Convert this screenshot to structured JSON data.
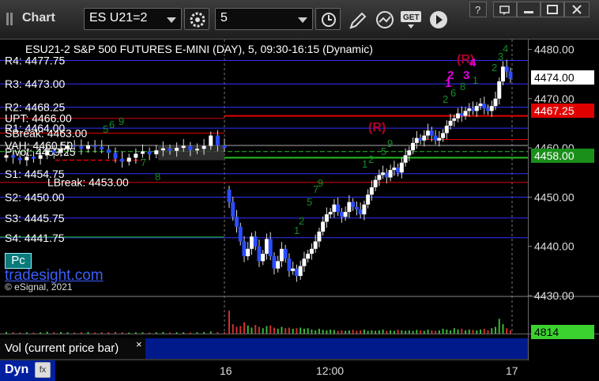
{
  "toolbar": {
    "title": "Chart",
    "symbol": "ES U21=2",
    "interval": "5",
    "icons": [
      "gear-icon",
      "clock-icon",
      "pencil-icon",
      "study-icon",
      "get-icon",
      "play-icon"
    ]
  },
  "window": {
    "icons": [
      "help-icon",
      "restore-icon",
      "minimize-icon",
      "maximize-icon",
      "close-icon"
    ]
  },
  "chart_header": "ESU21-2  S&P 500 FUTURES E-MINI (DAY), 5, 09:30-16:15 (Dynamic)",
  "price_axis": {
    "ticks": [
      "4480.00",
      "4470.00",
      "4460.00",
      "4450.00",
      "4440.00",
      "4430.00"
    ],
    "current_price": "4474.00",
    "alert_price": "4467.25",
    "green_level": "4458.00"
  },
  "time_axis": {
    "ticks": [
      "16",
      "12:00",
      "17"
    ]
  },
  "levels": [
    {
      "label": "R4: 4477.75",
      "color": "#3030ff"
    },
    {
      "label": "R3: 4473.00",
      "color": "#3030ff"
    },
    {
      "label": "R2: 4468.25",
      "color": "#3030ff"
    },
    {
      "label": "UPT: 4466.00",
      "color": "#e00000"
    },
    {
      "label": "R1: 4464.00",
      "color": "#3030ff"
    },
    {
      "label": "SBreak: 4463.00",
      "color": "#e00000"
    },
    {
      "label": "VAH: 4460.50",
      "color": "#ffffff"
    },
    {
      "label": "Pivot: 4459.25",
      "color": "#20c020"
    },
    {
      "label": "S1: 4454.75",
      "color": "#3030ff"
    },
    {
      "label": "LBreak: 4453.00",
      "color": "#e00000"
    },
    {
      "label": "S2: 4450.00",
      "color": "#3030ff"
    },
    {
      "label": "S3: 4445.75",
      "color": "#3030ff"
    },
    {
      "label": "S4: 4441.75",
      "color": "#3030ff"
    }
  ],
  "overlay": {
    "pc_button": "Pc",
    "brand": "tradesight.com",
    "copyright": "© eSignal, 2021"
  },
  "markers": {
    "r_left": "(R)",
    "r_right": "(R)",
    "seq": [
      "1",
      "2",
      "3",
      "4"
    ]
  },
  "volume": {
    "title": "Vol (current price bar)",
    "value": "4814",
    "close": "×"
  },
  "footer": {
    "dyn_label": "Dyn",
    "dyn_icon": "fx"
  },
  "chart_data": {
    "type": "candlestick",
    "title": "ESU21-2  S&P 500 FUTURES E-MINI (DAY), 5, 09:30-16:15 (Dynamic)",
    "ylim": [
      4430,
      4482
    ],
    "last_price": 4474.0,
    "volume_last": 4814,
    "reference_levels": [
      {
        "name": "R4",
        "value": 4477.75
      },
      {
        "name": "R3",
        "value": 4473.0
      },
      {
        "name": "R2",
        "value": 4468.25
      },
      {
        "name": "UPT",
        "value": 4466.0
      },
      {
        "name": "R1",
        "value": 4464.0
      },
      {
        "name": "SBreak",
        "value": 4463.0
      },
      {
        "name": "VAH",
        "value": 4460.5
      },
      {
        "name": "Pivot",
        "value": 4459.25
      },
      {
        "name": "S1",
        "value": 4454.75
      },
      {
        "name": "LBreak",
        "value": 4453.0
      },
      {
        "name": "S2",
        "value": 4450.0
      },
      {
        "name": "S3",
        "value": 4445.75
      },
      {
        "name": "S4",
        "value": 4441.75
      }
    ],
    "closes": [
      4458.5,
      4458.0,
      4457.5,
      4458.2,
      4457.8,
      4458.5,
      4459.5,
      4459.0,
      4459.8,
      4460.5,
      4460.3,
      4459.8,
      4460.5,
      4460.2,
      4459.7,
      4459.0,
      4457.8,
      4457.2,
      4458.0,
      4458.8,
      4459.3,
      4458.7,
      4459.5,
      4459.9,
      4459.4,
      4460.0,
      4460.4,
      4459.5,
      4459.8,
      4460.4,
      4462.5,
      4460.5,
      4460.0,
      4449.0,
      4446.0,
      4444.0,
      4441.0,
      4438.0,
      4439.5,
      4442.0,
      4440.0,
      4437.0,
      4438.5,
      4441.5,
      4438.0,
      4435.5,
      4437.0,
      4439.5,
      4437.5,
      4435.0,
      4435.5,
      4434.0,
      4436.0,
      4437.5,
      4438.5,
      4439.5,
      4441.0,
      4443.0,
      4445.0,
      4446.5,
      4447.0,
      4448.5,
      4447.0,
      4446.0,
      4447.0,
      4449.0,
      4448.0,
      4447.5,
      4446.5,
      4448.5,
      4450.5,
      4452.0,
      4453.5,
      4454.5,
      4455.0,
      4454.0,
      4455.5,
      4456.0,
      4455.0,
      4457.0,
      4458.5,
      4459.5,
      4461.0,
      4462.0,
      4461.5,
      4462.5,
      4463.5,
      4462.5,
      4461.5,
      4462.0,
      4463.0,
      4464.5,
      4465.5,
      4466.0,
      4467.0,
      4466.5,
      4467.5,
      4468.0,
      4467.5,
      4468.5,
      4469.0,
      4468.0,
      4467.5,
      4468.5,
      4470.0,
      4473.5,
      4476.5,
      4475.5,
      4474.0
    ],
    "volumes": [
      0.06,
      0.05,
      0.04,
      0.05,
      0.04,
      0.05,
      0.07,
      0.05,
      0.06,
      0.05,
      0.04,
      0.05,
      0.06,
      0.04,
      0.05,
      0.05,
      0.06,
      0.05,
      0.04,
      0.05,
      0.05,
      0.04,
      0.05,
      0.06,
      0.04,
      0.05,
      0.05,
      0.04,
      0.05,
      0.06,
      0.08,
      0.05,
      0.05,
      0.85,
      0.35,
      0.25,
      0.28,
      0.42,
      0.3,
      0.22,
      0.32,
      0.25,
      0.2,
      0.28,
      0.3,
      0.22,
      0.18,
      0.25,
      0.2,
      0.22,
      0.18,
      0.2,
      0.22,
      0.18,
      0.2,
      0.15,
      0.12,
      0.18,
      0.14,
      0.12,
      0.15,
      0.13,
      0.1,
      0.12,
      0.1,
      0.12,
      0.14,
      0.1,
      0.12,
      0.15,
      0.1,
      0.12,
      0.1,
      0.12,
      0.15,
      0.1,
      0.12,
      0.1,
      0.14,
      0.12,
      0.1,
      0.12,
      0.1,
      0.14,
      0.12,
      0.1,
      0.15,
      0.12,
      0.1,
      0.12,
      0.18,
      0.15,
      0.12,
      0.2,
      0.15,
      0.18,
      0.12,
      0.15,
      0.14,
      0.12,
      0.15,
      0.18,
      0.12,
      0.2,
      0.25,
      0.55,
      0.35,
      0.2,
      0.12
    ]
  }
}
